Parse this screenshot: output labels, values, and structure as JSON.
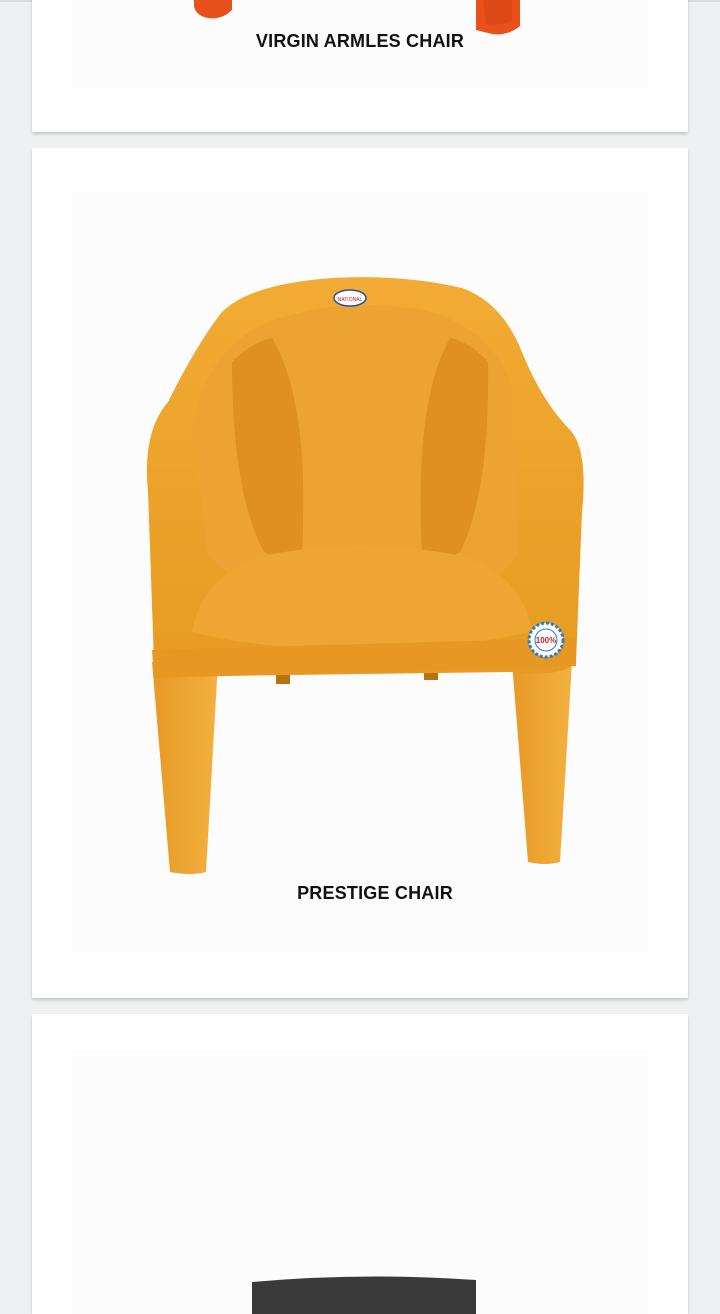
{
  "products": [
    {
      "name": "VIRGIN ARMLES CHAIR",
      "color": "#e8501c"
    },
    {
      "name": "PRESTIGE CHAIR",
      "color": "#f0a52a"
    },
    {
      "name": "",
      "color": "#3a3a3a"
    }
  ],
  "badges": {
    "brand_logo": "NATIONAL",
    "quality_seal": "100%"
  }
}
